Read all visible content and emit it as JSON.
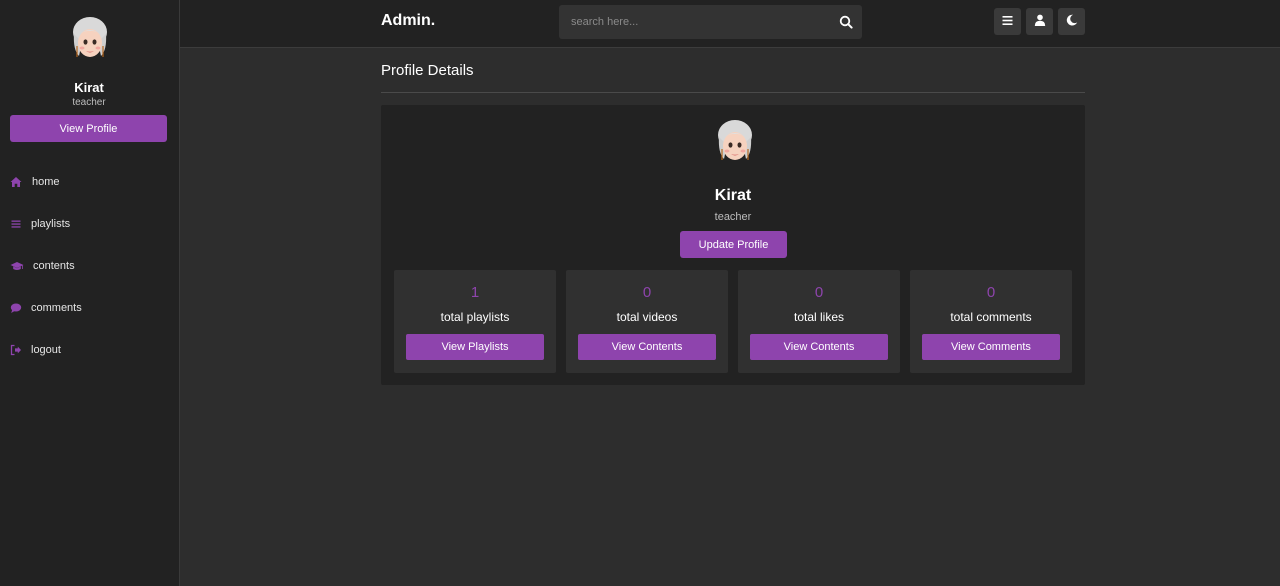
{
  "sidebar": {
    "user_name": "Kirat",
    "user_role": "teacher",
    "view_profile_label": "View Profile",
    "nav": [
      {
        "label": "home",
        "icon": "home-icon"
      },
      {
        "label": "playlists",
        "icon": "list-icon"
      },
      {
        "label": "contents",
        "icon": "graduation-cap-icon"
      },
      {
        "label": "comments",
        "icon": "comment-icon"
      },
      {
        "label": "logout",
        "icon": "logout-icon"
      }
    ]
  },
  "header": {
    "logo": "Admin.",
    "search_placeholder": "search here...",
    "buttons": [
      "menu-icon",
      "user-icon",
      "moon-icon"
    ]
  },
  "main": {
    "title": "Profile Details",
    "profile": {
      "name": "Kirat",
      "role": "teacher",
      "update_label": "Update Profile"
    },
    "stats": [
      {
        "value": "1",
        "label": "total playlists",
        "button": "View Playlists"
      },
      {
        "value": "0",
        "label": "total videos",
        "button": "View Contents"
      },
      {
        "value": "0",
        "label": "total likes",
        "button": "View Contents"
      },
      {
        "value": "0",
        "label": "total comments",
        "button": "View Comments"
      }
    ]
  },
  "colors": {
    "accent": "#8e44ad",
    "background": "#2d2d2d",
    "panel": "#222222"
  }
}
